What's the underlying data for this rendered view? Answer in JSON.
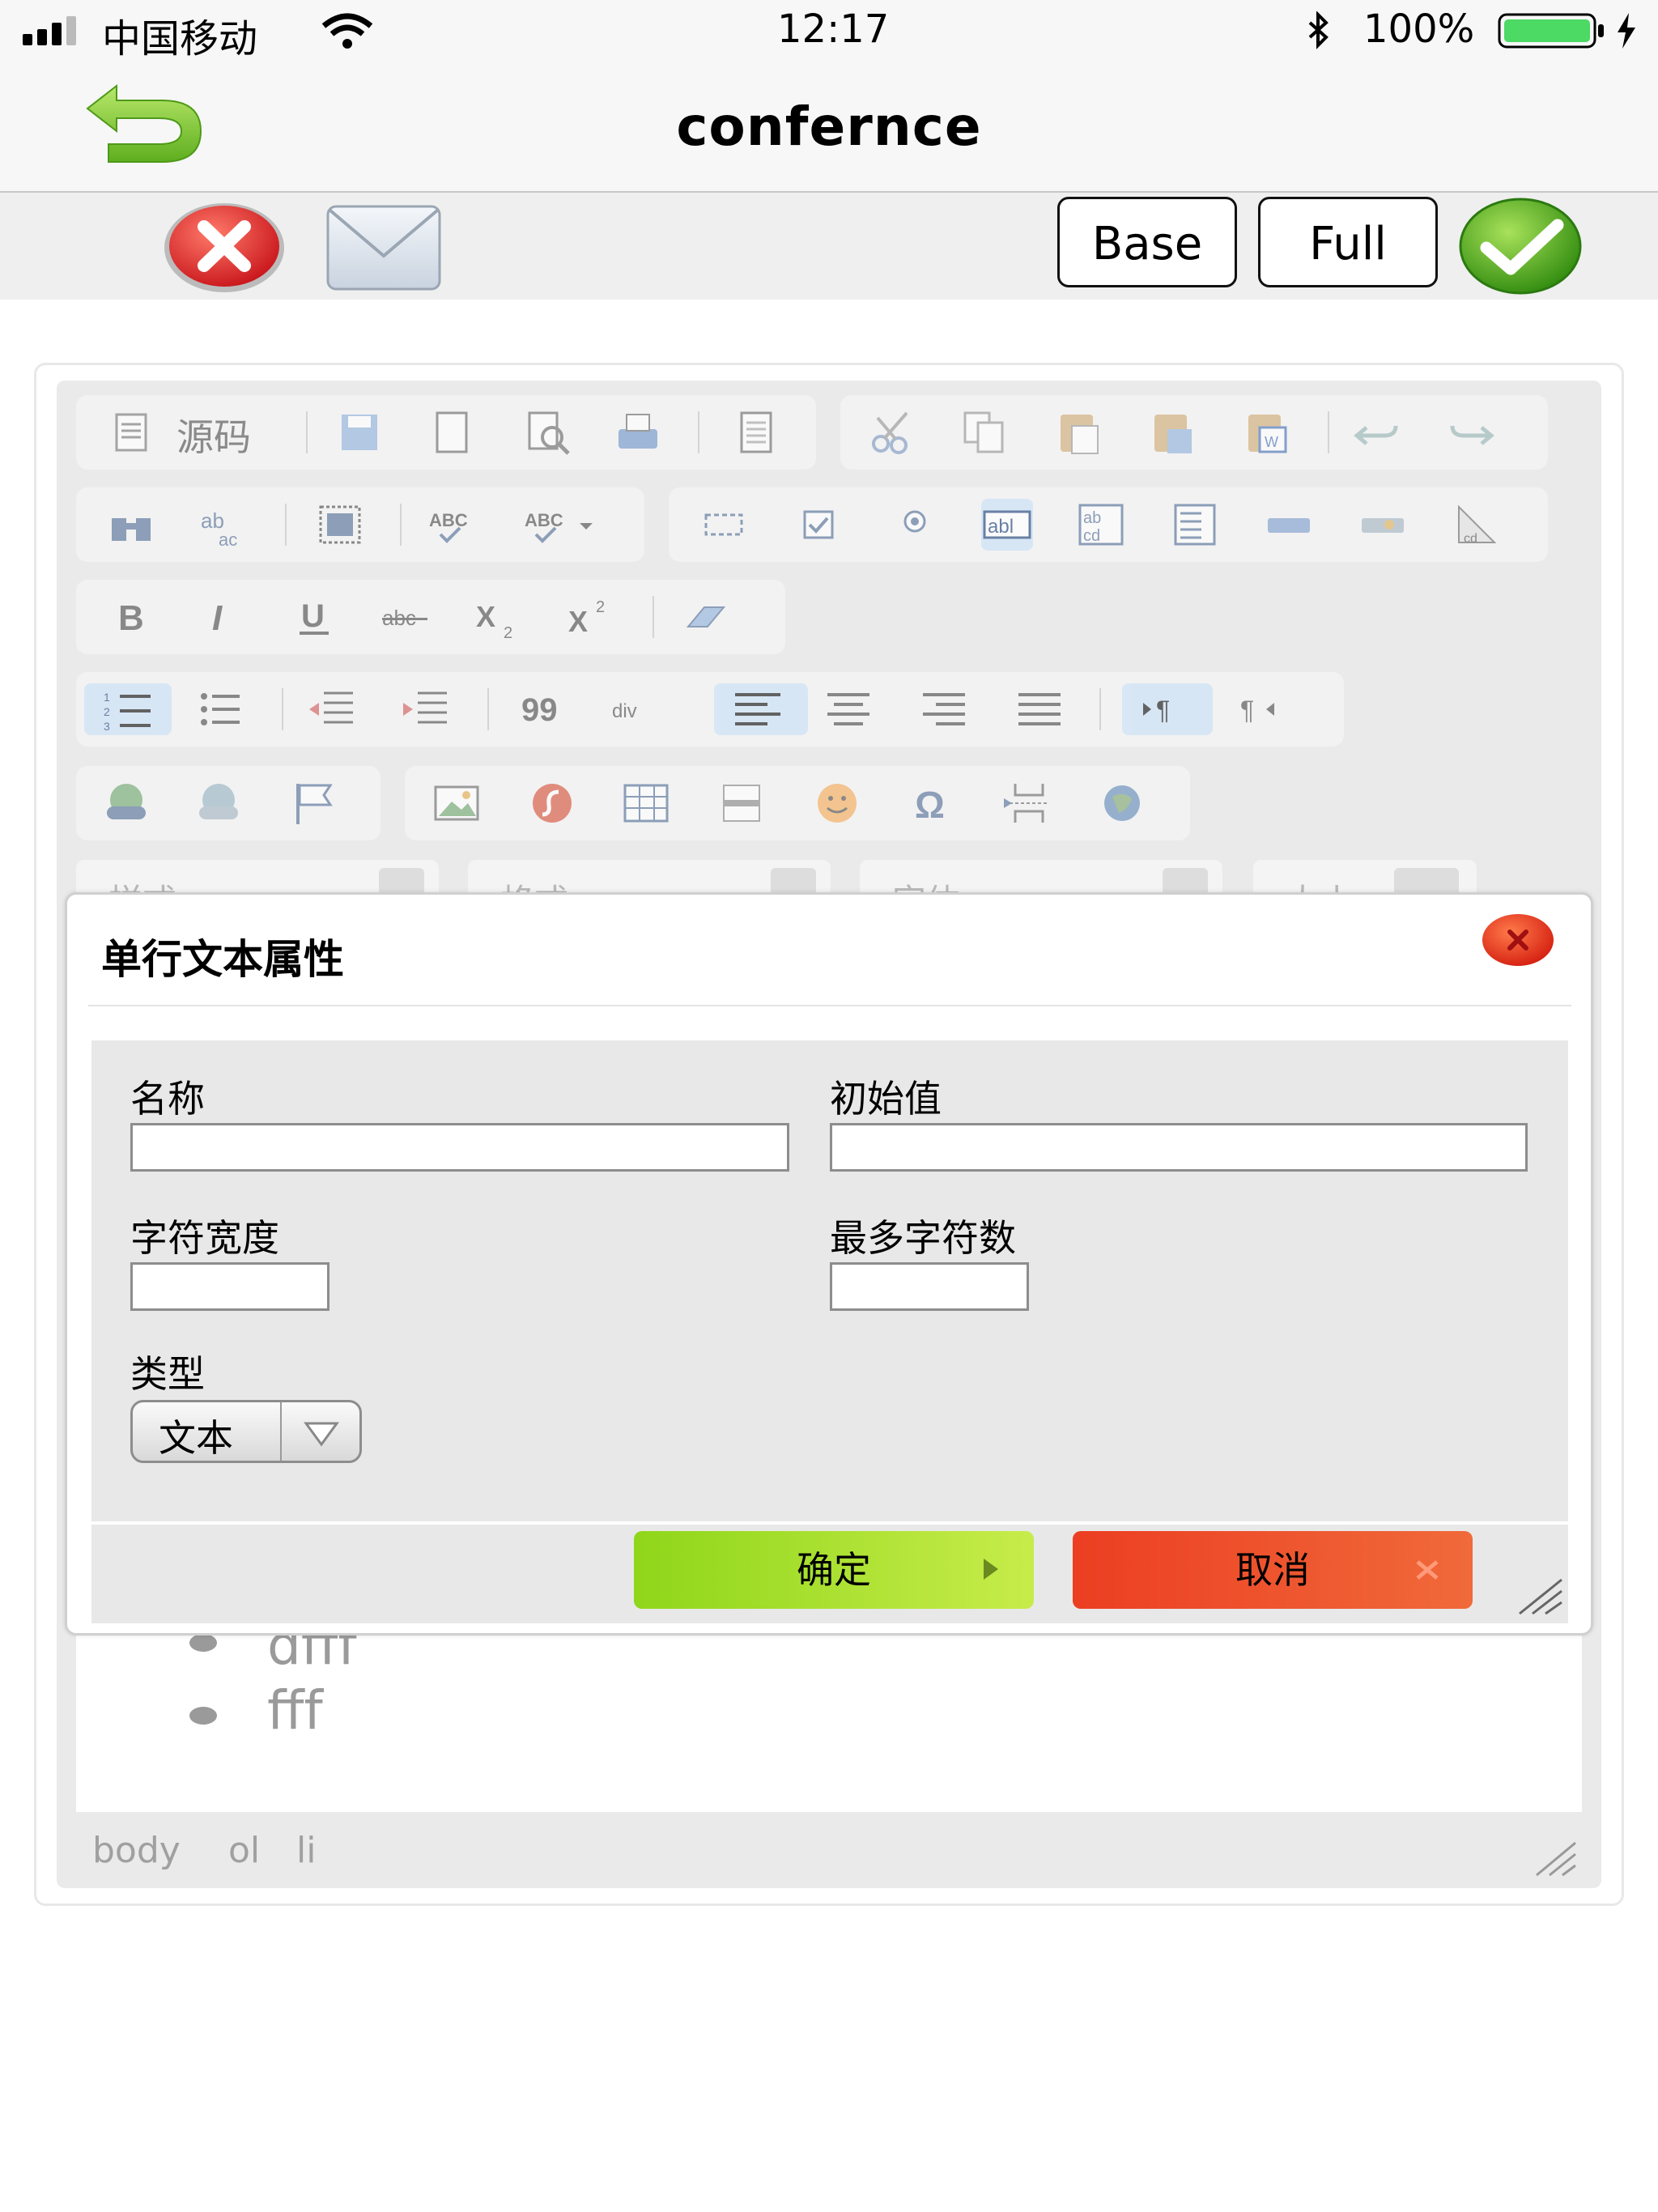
{
  "status_bar": {
    "carrier": "中国移动",
    "time": "12:17",
    "battery": "100%",
    "icons": [
      "signal-icon",
      "wifi-icon",
      "bluetooth-icon",
      "battery-icon",
      "charging-icon"
    ]
  },
  "nav": {
    "title": "confernce",
    "back_icon": "back-arrow-icon"
  },
  "action_bar": {
    "base_label": "Base",
    "full_label": "Full",
    "icons": [
      "delete-icon",
      "mail-icon",
      "confirm-check-icon"
    ]
  },
  "toolbar": {
    "source_label": "源码",
    "combos": [
      "样式",
      "格式",
      "字体",
      "大小"
    ]
  },
  "content": {
    "bullets": [
      "dfff",
      "fff"
    ]
  },
  "path": [
    "body",
    "ol",
    "li"
  ],
  "dialog": {
    "title": "单行文本属性",
    "fields": {
      "name_label": "名称",
      "initial_label": "初始值",
      "width_label": "字符宽度",
      "max_label": "最多字符数",
      "type_label": "类型",
      "type_value": "文本"
    },
    "ok_label": "确定",
    "cancel_label": "取消"
  },
  "colors": {
    "ok_green": "#9fdc1c",
    "cancel_red": "#ea4a24",
    "close_red": "#e8361c",
    "accent_blue": "#cfe3f6"
  }
}
